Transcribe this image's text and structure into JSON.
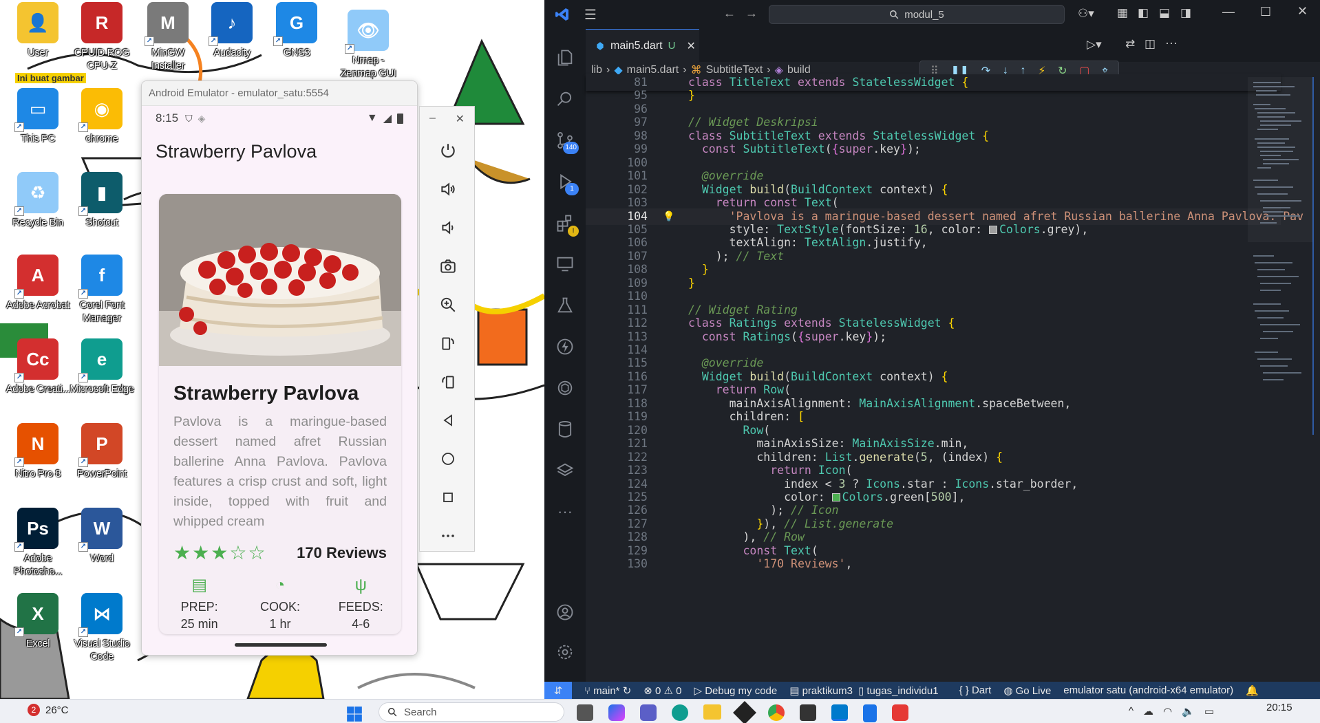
{
  "desktop": {
    "note": "Ini buat gambar",
    "icons": [
      {
        "label": "User",
        "color": "#f4c430",
        "glyph": "👤"
      },
      {
        "label": "CPUID ROG CPU-Z",
        "color": "#c62828",
        "glyph": "R"
      },
      {
        "label": "MinGW Installer",
        "color": "#7a7a7a",
        "glyph": "M"
      },
      {
        "label": "Audacity",
        "color": "#1565c0",
        "glyph": "♪"
      },
      {
        "label": "GNS3",
        "color": "#1e88e5",
        "glyph": "G"
      },
      {
        "label": "Nmap - Zenmap GUI",
        "color": "#90caf9",
        "glyph": "👁"
      },
      {
        "label": "This PC",
        "color": "#1e88e5",
        "glyph": "▭"
      },
      {
        "label": "chrome",
        "color": "#fbbc05",
        "glyph": "◉"
      },
      {
        "label": "Recycle Bin",
        "color": "#90caf9",
        "glyph": "♻"
      },
      {
        "label": "Shotcut",
        "color": "#0d5c6b",
        "glyph": "▮"
      },
      {
        "label": "Adobe Acrobat",
        "color": "#d32f2f",
        "glyph": "A"
      },
      {
        "label": "Corel Font Manager",
        "color": "#1e88e5",
        "glyph": "f"
      },
      {
        "label": "Adobe Creati...",
        "color": "#d32f2f",
        "glyph": "Cc"
      },
      {
        "label": "Microsoft Edge",
        "color": "#0f9d8f",
        "glyph": "e"
      },
      {
        "label": "Nitro Pro 8",
        "color": "#e65100",
        "glyph": "N"
      },
      {
        "label": "PowerPoint",
        "color": "#d24726",
        "glyph": "P"
      },
      {
        "label": "Adobe Photosho...",
        "color": "#001e36",
        "glyph": "Ps"
      },
      {
        "label": "Word",
        "color": "#2b579a",
        "glyph": "W"
      },
      {
        "label": "Excel",
        "color": "#217346",
        "glyph": "X"
      },
      {
        "label": "Visual Studio Code",
        "color": "#007acc",
        "glyph": "⋈"
      }
    ]
  },
  "emulator": {
    "title": "Android Emulator - emulator_satu:5554",
    "time": "8:15",
    "app_title": "Strawberry Pavlova",
    "card_title": "Strawberry Pavlova",
    "description": "Pavlova is a maringue-based dessert named afret Russian ballerine Anna Pavlova. Pavlova features a crisp crust and soft, light inside, topped with fruit and whipped cream",
    "rating_filled": 3,
    "rating_max": 5,
    "reviews": "170 Reviews",
    "info": [
      {
        "icon": "kitchen-icon",
        "label": "PREP:",
        "value": "25 min"
      },
      {
        "icon": "timer-icon",
        "label": "COOK:",
        "value": "1 hr"
      },
      {
        "icon": "restaurant-icon",
        "label": "FEEDS:",
        "value": "4-6"
      }
    ],
    "accent": "#4caf50"
  },
  "emulator_toolbar": {
    "minimize": "–",
    "close": "✕",
    "buttons": [
      "power-icon",
      "volume-up-icon",
      "volume-down-icon",
      "camera-icon",
      "zoom-icon",
      "rotate-left-icon",
      "rotate-right-icon",
      "back-icon",
      "home-icon",
      "overview-icon",
      "more-icon"
    ]
  },
  "vscode": {
    "search": "modul_5",
    "tab": {
      "name": "main5.dart",
      "status": "U"
    },
    "breadcrumb": [
      "lib",
      "main5.dart",
      "SubtitleText",
      "build"
    ],
    "activity_badges": {
      "source_control": "140",
      "run": "1"
    },
    "code_lines": [
      {
        "n": "81",
        "html": "<span class='k'>class</span> <span class='t'>TitleText</span> <span class='k'>extends</span> <span class='t'>StatelessWidget</span> <span class='b'>{</span>",
        "sticky": true
      },
      {
        "n": "95",
        "html": "<span class='b'>}</span>"
      },
      {
        "n": "96",
        "html": ""
      },
      {
        "n": "97",
        "html": "<span class='c'>// Widget Deskripsi</span>"
      },
      {
        "n": "98",
        "html": "<span class='k'>class</span> <span class='t'>SubtitleText</span> <span class='k'>extends</span> <span class='t'>StatelessWidget</span> <span class='b'>{</span>"
      },
      {
        "n": "99",
        "html": "  <span class='k'>const</span> <span class='t'>SubtitleText</span>(<span class='b2'>{</span><span class='k'>super</span>.key<span class='b2'>}</span>);"
      },
      {
        "n": "100",
        "html": ""
      },
      {
        "n": "101",
        "html": "  <span class='c'>@override</span>"
      },
      {
        "n": "102",
        "html": "  <span class='t'>Widget</span> <span class='f'>build</span>(<span class='t'>BuildContext</span> context) <span class='b'>{</span>"
      },
      {
        "n": "103",
        "html": "    <span class='k'>return</span> <span class='k'>const</span> <span class='t'>Text</span>("
      },
      {
        "n": "104",
        "html": "      <span class='s'>'Pavlova is a maringue-based dessert named afret Russian ballerine Anna Pavlova. Pav</span>",
        "active": true
      },
      {
        "n": "105",
        "html": "      style: <span class='t'>TextStyle</span>(fontSize: <span class='num'>16</span>, color: <span class='sw sw-grey'></span><span class='t'>Colors</span>.grey),"
      },
      {
        "n": "106",
        "html": "      textAlign: <span class='t'>TextAlign</span>.justify,"
      },
      {
        "n": "107",
        "html": "    ); <span class='c'>// Text</span>"
      },
      {
        "n": "108",
        "html": "  <span class='b'>}</span>"
      },
      {
        "n": "109",
        "html": "<span class='b'>}</span>"
      },
      {
        "n": "110",
        "html": ""
      },
      {
        "n": "111",
        "html": "<span class='c'>// Widget Rating</span>"
      },
      {
        "n": "112",
        "html": "<span class='k'>class</span> <span class='t'>Ratings</span> <span class='k'>extends</span> <span class='t'>StatelessWidget</span> <span class='b'>{</span>"
      },
      {
        "n": "113",
        "html": "  <span class='k'>const</span> <span class='t'>Ratings</span>(<span class='b2'>{</span><span class='k'>super</span>.key<span class='b2'>}</span>);"
      },
      {
        "n": "114",
        "html": ""
      },
      {
        "n": "115",
        "html": "  <span class='c'>@override</span>"
      },
      {
        "n": "116",
        "html": "  <span class='t'>Widget</span> <span class='f'>build</span>(<span class='t'>BuildContext</span> context) <span class='b'>{</span>"
      },
      {
        "n": "117",
        "html": "    <span class='k'>return</span> <span class='t'>Row</span>("
      },
      {
        "n": "118",
        "html": "      mainAxisAlignment: <span class='t'>MainAxisAlignment</span>.spaceBetween,"
      },
      {
        "n": "119",
        "html": "      children: <span class='b'>[</span>"
      },
      {
        "n": "120",
        "html": "        <span class='t'>Row</span>("
      },
      {
        "n": "121",
        "html": "          mainAxisSize: <span class='t'>MainAxisSize</span>.min,"
      },
      {
        "n": "122",
        "html": "          children: <span class='t'>List</span>.<span class='f'>generate</span>(<span class='num'>5</span>, (index) <span class='b'>{</span>"
      },
      {
        "n": "123",
        "html": "            <span class='k'>return</span> <span class='t'>Icon</span>("
      },
      {
        "n": "124",
        "html": "              index &lt; <span class='num'>3</span> ? <span class='t'>Icons</span>.star : <span class='t'>Icons</span>.star_border,"
      },
      {
        "n": "125",
        "html": "              color: <span class='sw sw-green'></span><span class='t'>Colors</span>.green[<span class='num'>500</span>],"
      },
      {
        "n": "126",
        "html": "            ); <span class='c'>// Icon</span>"
      },
      {
        "n": "127",
        "html": "          <span class='b'>}</span>), <span class='c'>// List.generate</span>"
      },
      {
        "n": "128",
        "html": "        ), <span class='c'>// Row</span>"
      },
      {
        "n": "129",
        "html": "        <span class='k'>const</span> <span class='t'>Text</span>("
      },
      {
        "n": "130",
        "html": "          <span class='s'>'170 Reviews'</span>,"
      }
    ],
    "status_bar": {
      "branch": "main*",
      "problems": "⊗ 0 ⚠ 0",
      "debug": "Debug my code",
      "project": "praktikum3",
      "folder": "tugas_individu1",
      "language": "{ } Dart",
      "golive": "Go Live",
      "device": "emulator satu (android-x64 emulator)"
    }
  },
  "taskbar": {
    "weather_badge": "2",
    "temperature": "26°C",
    "search_placeholder": "Search",
    "clock": "20:15"
  }
}
